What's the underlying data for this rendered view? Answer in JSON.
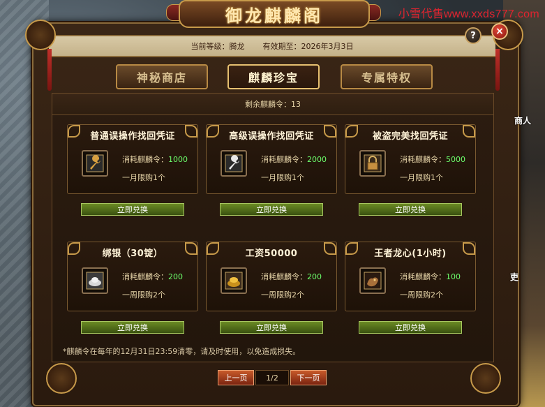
{
  "watermark": "小雪代售www.xxds777.com",
  "side": {
    "npc_label": "商人",
    "other_label": "吏"
  },
  "window": {
    "title": "御龙麒麟阁",
    "help_label": "?",
    "close_label": "×"
  },
  "info": {
    "level_text": "当前等级：腾龙",
    "expiry_text": "有效期至：2026年3月3日"
  },
  "tabs": [
    {
      "label": "神秘商店",
      "active": false
    },
    {
      "label": "麒麟珍宝",
      "active": true
    },
    {
      "label": "专属特权",
      "active": false
    }
  ],
  "remaining_text": "剩余麒麟令：13",
  "items": [
    {
      "name": "普通误操作找回凭证",
      "cost_prefix": "消耗麒麟令：",
      "cost": "1000",
      "limit": "一月限购1个",
      "icon": "wrench-icon",
      "button": "立即兑换"
    },
    {
      "name": "高级误操作找回凭证",
      "cost_prefix": "消耗麒麟令：",
      "cost": "2000",
      "limit": "一月限购1个",
      "icon": "wrench-icon",
      "button": "立即兑换"
    },
    {
      "name": "被盗完美找回凭证",
      "cost_prefix": "消耗麒麟令：",
      "cost": "5000",
      "limit": "一月限购1个",
      "icon": "lock-icon",
      "button": "立即兑换"
    },
    {
      "name": "绑银（30锭）",
      "cost_prefix": "消耗麒麟令：",
      "cost": "200",
      "limit": "一周限购2个",
      "icon": "silver-ingot-icon",
      "button": "立即兑换"
    },
    {
      "name": "工资50000",
      "cost_prefix": "消耗麒麟令：",
      "cost": "200",
      "limit": "一周限购2个",
      "icon": "gold-ingot-icon",
      "button": "立即兑换"
    },
    {
      "name": "王者龙心(1小时)",
      "cost_prefix": "消耗麒麟令：",
      "cost": "100",
      "limit": "一周限购2个",
      "icon": "dragon-heart-icon",
      "button": "立即兑换"
    }
  ],
  "note": "*麒麟令在每年的12月31日23:59清零，请及时使用，以免造成损失。",
  "pagination": {
    "prev": "上一页",
    "page": "1/2",
    "next": "下一页"
  },
  "colors": {
    "cost_number": "#6cff6c",
    "redeem_button": "#4a6a18",
    "page_button": "#a8401c",
    "watermark": "#e0242f"
  }
}
